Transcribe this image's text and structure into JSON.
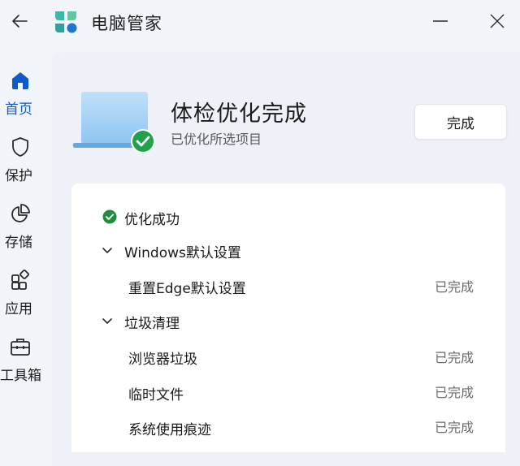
{
  "window": {
    "title": "电脑管家"
  },
  "sidebar": {
    "items": [
      {
        "label": "首页",
        "icon": "home-icon",
        "active": true
      },
      {
        "label": "保护",
        "icon": "shield-icon",
        "active": false
      },
      {
        "label": "存储",
        "icon": "pie-chart-icon",
        "active": false
      },
      {
        "label": "应用",
        "icon": "apps-icon",
        "active": false
      },
      {
        "label": "工具箱",
        "icon": "toolbox-icon",
        "active": false
      }
    ]
  },
  "hero": {
    "title": "体检优化完成",
    "subtitle": "已优化所选项目",
    "done_button": "完成"
  },
  "results": {
    "summary": "优化成功",
    "groups": [
      {
        "title": "Windows默认设置",
        "items": [
          {
            "label": "重置Edge默认设置",
            "status": "已完成"
          }
        ]
      },
      {
        "title": "垃圾清理",
        "items": [
          {
            "label": "浏览器垃圾",
            "status": "已完成"
          },
          {
            "label": "临时文件",
            "status": "已完成"
          },
          {
            "label": "系统使用痕迹",
            "status": "已完成"
          }
        ]
      }
    ]
  },
  "colors": {
    "accent": "#0b5cc9",
    "success": "#1e8e3e",
    "background": "#f1f4f9",
    "card": "#ffffff"
  }
}
